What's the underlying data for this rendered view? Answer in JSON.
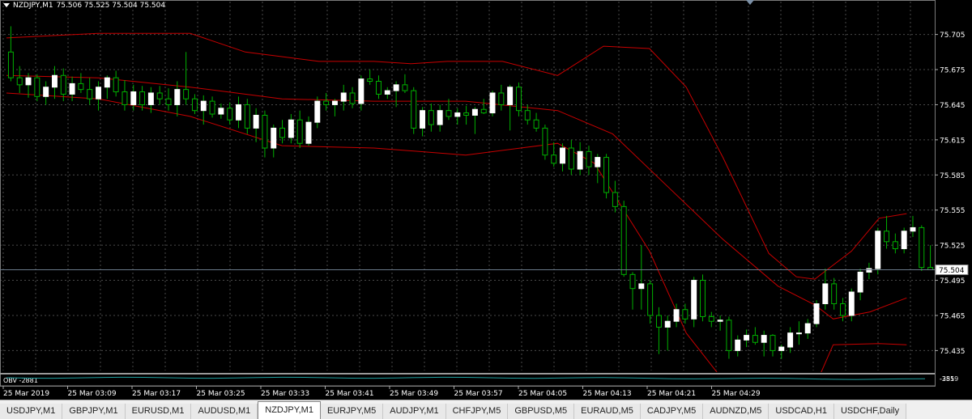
{
  "header": {
    "symbol_tf": "NZDJPY,M1",
    "ohlc": "75.506 75.525 75.504 75.504"
  },
  "indicator": {
    "label": "OBV -2881",
    "scale_top": "-355",
    "scale_bottom": "-2819"
  },
  "price_scale": [
    "75.705",
    "75.675",
    "75.645",
    "75.615",
    "75.585",
    "75.555",
    "75.525",
    "75.495",
    "75.465",
    "75.435"
  ],
  "current_price": "75.504",
  "time_labels": [
    "25 Mar 2019",
    "25 Mar 03:09",
    "25 Mar 03:17",
    "25 Mar 03:25",
    "25 Mar 03:33",
    "25 Mar 03:41",
    "25 Mar 03:49",
    "25 Mar 03:57",
    "25 Mar 04:05",
    "25 Mar 04:13",
    "25 Mar 04:21",
    "25 Mar 04:29"
  ],
  "tabs": [
    "USDJPY,M1",
    "GBPJPY,M1",
    "EURUSD,M1",
    "AUDUSD,M1",
    "NZDJPY,M1",
    "EURJPY,M5",
    "AUDJPY,M1",
    "CHFJPY,M5",
    "GBPUSD,M5",
    "EURAUD,M5",
    "CADJPY,M5",
    "AUDNZD,M5",
    "USDCAD,H1",
    "USDCHF,Daily"
  ],
  "active_tab": "NZDJPY,M1",
  "colors": {
    "background": "#000000",
    "bull_candle": "#ffffff",
    "bear_candle": "#000000",
    "wick": "#00b000",
    "bands": "#c80000",
    "grid": "#4a4a4a",
    "obv_line": "#20a0a0"
  },
  "chart_data": {
    "type": "candlestick",
    "symbol": "NZDJPY",
    "timeframe": "M1",
    "ylim": [
      75.418,
      75.722
    ],
    "candles": [
      {
        "o": 75.69,
        "h": 75.712,
        "l": 75.665,
        "c": 75.668
      },
      {
        "o": 75.668,
        "h": 75.678,
        "l": 75.655,
        "c": 75.662
      },
      {
        "o": 75.662,
        "h": 75.672,
        "l": 75.651,
        "c": 75.668
      },
      {
        "o": 75.668,
        "h": 75.671,
        "l": 75.648,
        "c": 75.652
      },
      {
        "o": 75.652,
        "h": 75.665,
        "l": 75.645,
        "c": 75.66
      },
      {
        "o": 75.66,
        "h": 75.678,
        "l": 75.65,
        "c": 75.67
      },
      {
        "o": 75.67,
        "h": 75.676,
        "l": 75.648,
        "c": 75.654
      },
      {
        "o": 75.654,
        "h": 75.669,
        "l": 75.648,
        "c": 75.663
      },
      {
        "o": 75.663,
        "h": 75.672,
        "l": 75.655,
        "c": 75.658
      },
      {
        "o": 75.658,
        "h": 75.668,
        "l": 75.645,
        "c": 75.65
      },
      {
        "o": 75.65,
        "h": 75.665,
        "l": 75.64,
        "c": 75.66
      },
      {
        "o": 75.66,
        "h": 75.67,
        "l": 75.65,
        "c": 75.668
      },
      {
        "o": 75.668,
        "h": 75.674,
        "l": 75.652,
        "c": 75.656
      },
      {
        "o": 75.656,
        "h": 75.666,
        "l": 75.64,
        "c": 75.645
      },
      {
        "o": 75.645,
        "h": 75.662,
        "l": 75.64,
        "c": 75.656
      },
      {
        "o": 75.656,
        "h": 75.661,
        "l": 75.64,
        "c": 75.645
      },
      {
        "o": 75.645,
        "h": 75.66,
        "l": 75.638,
        "c": 75.655
      },
      {
        "o": 75.655,
        "h": 75.661,
        "l": 75.645,
        "c": 75.65
      },
      {
        "o": 75.65,
        "h": 75.659,
        "l": 75.64,
        "c": 75.645
      },
      {
        "o": 75.645,
        "h": 75.665,
        "l": 75.635,
        "c": 75.658
      },
      {
        "o": 75.658,
        "h": 75.69,
        "l": 75.645,
        "c": 75.65
      },
      {
        "o": 75.65,
        "h": 75.654,
        "l": 75.637,
        "c": 75.64
      },
      {
        "o": 75.64,
        "h": 75.653,
        "l": 75.628,
        "c": 75.648
      },
      {
        "o": 75.648,
        "h": 75.652,
        "l": 75.634,
        "c": 75.637
      },
      {
        "o": 75.637,
        "h": 75.646,
        "l": 75.633,
        "c": 75.642
      },
      {
        "o": 75.642,
        "h": 75.647,
        "l": 75.628,
        "c": 75.632
      },
      {
        "o": 75.632,
        "h": 75.652,
        "l": 75.625,
        "c": 75.645
      },
      {
        "o": 75.645,
        "h": 75.65,
        "l": 75.62,
        "c": 75.625
      },
      {
        "o": 75.625,
        "h": 75.642,
        "l": 75.613,
        "c": 75.636
      },
      {
        "o": 75.636,
        "h": 75.64,
        "l": 75.6,
        "c": 75.608
      },
      {
        "o": 75.608,
        "h": 75.628,
        "l": 75.6,
        "c": 75.625
      },
      {
        "o": 75.625,
        "h": 75.632,
        "l": 75.612,
        "c": 75.617
      },
      {
        "o": 75.617,
        "h": 75.637,
        "l": 75.612,
        "c": 75.632
      },
      {
        "o": 75.632,
        "h": 75.64,
        "l": 75.608,
        "c": 75.612
      },
      {
        "o": 75.612,
        "h": 75.635,
        "l": 75.61,
        "c": 75.63
      },
      {
        "o": 75.63,
        "h": 75.652,
        "l": 75.625,
        "c": 75.648
      },
      {
        "o": 75.648,
        "h": 75.655,
        "l": 75.64,
        "c": 75.645
      },
      {
        "o": 75.645,
        "h": 75.65,
        "l": 75.635,
        "c": 75.648
      },
      {
        "o": 75.648,
        "h": 75.662,
        "l": 75.64,
        "c": 75.655
      },
      {
        "o": 75.655,
        "h": 75.66,
        "l": 75.642,
        "c": 75.646
      },
      {
        "o": 75.646,
        "h": 75.67,
        "l": 75.64,
        "c": 75.667
      },
      {
        "o": 75.667,
        "h": 75.675,
        "l": 75.662,
        "c": 75.665
      },
      {
        "o": 75.665,
        "h": 75.67,
        "l": 75.65,
        "c": 75.654
      },
      {
        "o": 75.654,
        "h": 75.66,
        "l": 75.65,
        "c": 75.657
      },
      {
        "o": 75.657,
        "h": 75.665,
        "l": 75.643,
        "c": 75.662
      },
      {
        "o": 75.662,
        "h": 75.671,
        "l": 75.655,
        "c": 75.657
      },
      {
        "o": 75.657,
        "h": 75.66,
        "l": 75.62,
        "c": 75.625
      },
      {
        "o": 75.625,
        "h": 75.643,
        "l": 75.618,
        "c": 75.64
      },
      {
        "o": 75.64,
        "h": 75.646,
        "l": 75.622,
        "c": 75.628
      },
      {
        "o": 75.628,
        "h": 75.645,
        "l": 75.622,
        "c": 75.64
      },
      {
        "o": 75.64,
        "h": 75.65,
        "l": 75.632,
        "c": 75.635
      },
      {
        "o": 75.635,
        "h": 75.642,
        "l": 75.628,
        "c": 75.638
      },
      {
        "o": 75.638,
        "h": 75.644,
        "l": 75.628,
        "c": 75.636
      },
      {
        "o": 75.636,
        "h": 75.643,
        "l": 75.62,
        "c": 75.641
      },
      {
        "o": 75.641,
        "h": 75.65,
        "l": 75.637,
        "c": 75.638
      },
      {
        "o": 75.638,
        "h": 75.657,
        "l": 75.635,
        "c": 75.655
      },
      {
        "o": 75.655,
        "h": 75.662,
        "l": 75.64,
        "c": 75.645
      },
      {
        "o": 75.645,
        "h": 75.662,
        "l": 75.623,
        "c": 75.66
      },
      {
        "o": 75.66,
        "h": 75.664,
        "l": 75.635,
        "c": 75.64
      },
      {
        "o": 75.64,
        "h": 75.645,
        "l": 75.628,
        "c": 75.632
      },
      {
        "o": 75.632,
        "h": 75.638,
        "l": 75.622,
        "c": 75.625
      },
      {
        "o": 75.625,
        "h": 75.628,
        "l": 75.598,
        "c": 75.602
      },
      {
        "o": 75.602,
        "h": 75.613,
        "l": 75.592,
        "c": 75.595
      },
      {
        "o": 75.595,
        "h": 75.612,
        "l": 75.588,
        "c": 75.608
      },
      {
        "o": 75.608,
        "h": 75.615,
        "l": 75.585,
        "c": 75.59
      },
      {
        "o": 75.59,
        "h": 75.613,
        "l": 75.585,
        "c": 75.605
      },
      {
        "o": 75.605,
        "h": 75.61,
        "l": 75.585,
        "c": 75.592
      },
      {
        "o": 75.592,
        "h": 75.603,
        "l": 75.578,
        "c": 75.6
      },
      {
        "o": 75.6,
        "h": 75.603,
        "l": 75.565,
        "c": 75.57
      },
      {
        "o": 75.57,
        "h": 75.58,
        "l": 75.553,
        "c": 75.558
      },
      {
        "o": 75.558,
        "h": 75.563,
        "l": 75.498,
        "c": 75.5
      },
      {
        "o": 75.5,
        "h": 75.502,
        "l": 75.47,
        "c": 75.488
      },
      {
        "o": 75.488,
        "h": 75.525,
        "l": 75.47,
        "c": 75.492
      },
      {
        "o": 75.492,
        "h": 75.495,
        "l": 75.458,
        "c": 75.465
      },
      {
        "o": 75.465,
        "h": 75.472,
        "l": 75.432,
        "c": 75.455
      },
      {
        "o": 75.455,
        "h": 75.465,
        "l": 75.435,
        "c": 75.46
      },
      {
        "o": 75.46,
        "h": 75.475,
        "l": 75.455,
        "c": 75.47
      },
      {
        "o": 75.47,
        "h": 75.475,
        "l": 75.458,
        "c": 75.462
      },
      {
        "o": 75.462,
        "h": 75.498,
        "l": 75.455,
        "c": 75.495
      },
      {
        "o": 75.495,
        "h": 75.5,
        "l": 75.46,
        "c": 75.464
      },
      {
        "o": 75.464,
        "h": 75.468,
        "l": 75.455,
        "c": 75.46
      },
      {
        "o": 75.46,
        "h": 75.465,
        "l": 75.452,
        "c": 75.461
      },
      {
        "o": 75.461,
        "h": 75.464,
        "l": 75.428,
        "c": 75.435
      },
      {
        "o": 75.435,
        "h": 75.448,
        "l": 75.43,
        "c": 75.444
      },
      {
        "o": 75.444,
        "h": 75.453,
        "l": 75.438,
        "c": 75.448
      },
      {
        "o": 75.448,
        "h": 75.455,
        "l": 75.44,
        "c": 75.442
      },
      {
        "o": 75.442,
        "h": 75.452,
        "l": 75.43,
        "c": 75.448
      },
      {
        "o": 75.448,
        "h": 75.449,
        "l": 75.43,
        "c": 75.435
      },
      {
        "o": 75.435,
        "h": 75.44,
        "l": 75.428,
        "c": 75.438
      },
      {
        "o": 75.438,
        "h": 75.455,
        "l": 75.433,
        "c": 75.45
      },
      {
        "o": 75.45,
        "h": 75.46,
        "l": 75.44,
        "c": 75.45
      },
      {
        "o": 75.45,
        "h": 75.462,
        "l": 75.445,
        "c": 75.458
      },
      {
        "o": 75.458,
        "h": 75.478,
        "l": 75.455,
        "c": 75.475
      },
      {
        "o": 75.475,
        "h": 75.505,
        "l": 75.47,
        "c": 75.492
      },
      {
        "o": 75.492,
        "h": 75.497,
        "l": 75.47,
        "c": 75.475
      },
      {
        "o": 75.475,
        "h": 75.48,
        "l": 75.46,
        "c": 75.465
      },
      {
        "o": 75.465,
        "h": 75.488,
        "l": 75.46,
        "c": 75.485
      },
      {
        "o": 75.485,
        "h": 75.505,
        "l": 75.478,
        "c": 75.502
      },
      {
        "o": 75.502,
        "h": 75.51,
        "l": 75.496,
        "c": 75.505
      },
      {
        "o": 75.505,
        "h": 75.54,
        "l": 75.5,
        "c": 75.537
      },
      {
        "o": 75.537,
        "h": 75.55,
        "l": 75.522,
        "c": 75.528
      },
      {
        "o": 75.528,
        "h": 75.535,
        "l": 75.518,
        "c": 75.522
      },
      {
        "o": 75.522,
        "h": 75.54,
        "l": 75.518,
        "c": 75.537
      },
      {
        "o": 75.537,
        "h": 75.55,
        "l": 75.532,
        "c": 75.54
      },
      {
        "o": 75.54,
        "h": 75.542,
        "l": 75.503,
        "c": 75.506
      },
      {
        "o": 75.506,
        "h": 75.525,
        "l": 75.504,
        "c": 75.504
      }
    ],
    "bollinger_upper": [
      [
        0,
        75.702
      ],
      [
        0.1,
        75.706
      ],
      [
        0.2,
        75.706
      ],
      [
        0.26,
        75.69
      ],
      [
        0.34,
        75.682
      ],
      [
        0.4,
        75.682
      ],
      [
        0.44,
        75.68
      ],
      [
        0.48,
        75.682
      ],
      [
        0.54,
        75.682
      ],
      [
        0.6,
        75.67
      ],
      [
        0.65,
        75.695
      ],
      [
        0.7,
        75.693
      ],
      [
        0.74,
        75.66
      ],
      [
        0.78,
        75.6
      ],
      [
        0.83,
        75.518
      ],
      [
        0.86,
        75.498
      ],
      [
        0.88,
        75.496
      ],
      [
        0.92,
        75.52
      ],
      [
        0.95,
        75.548
      ],
      [
        0.98,
        75.552
      ]
    ],
    "bollinger_middle": [
      [
        0,
        75.67
      ],
      [
        0.1,
        75.668
      ],
      [
        0.2,
        75.66
      ],
      [
        0.3,
        75.65
      ],
      [
        0.4,
        75.648
      ],
      [
        0.5,
        75.648
      ],
      [
        0.6,
        75.64
      ],
      [
        0.66,
        75.62
      ],
      [
        0.72,
        75.575
      ],
      [
        0.78,
        75.53
      ],
      [
        0.84,
        75.49
      ],
      [
        0.88,
        75.474
      ],
      [
        0.9,
        75.462
      ],
      [
        0.94,
        75.468
      ],
      [
        0.98,
        75.48
      ]
    ],
    "bollinger_lower": [
      [
        0,
        75.655
      ],
      [
        0.1,
        75.65
      ],
      [
        0.2,
        75.635
      ],
      [
        0.3,
        75.61
      ],
      [
        0.4,
        75.608
      ],
      [
        0.5,
        75.602
      ],
      [
        0.6,
        75.612
      ],
      [
        0.64,
        75.595
      ],
      [
        0.7,
        75.52
      ],
      [
        0.74,
        75.45
      ],
      [
        0.78,
        75.41
      ],
      [
        0.83,
        75.38
      ],
      [
        0.88,
        75.404
      ],
      [
        0.9,
        75.44
      ],
      [
        0.95,
        75.441
      ],
      [
        0.98,
        75.44
      ]
    ]
  }
}
